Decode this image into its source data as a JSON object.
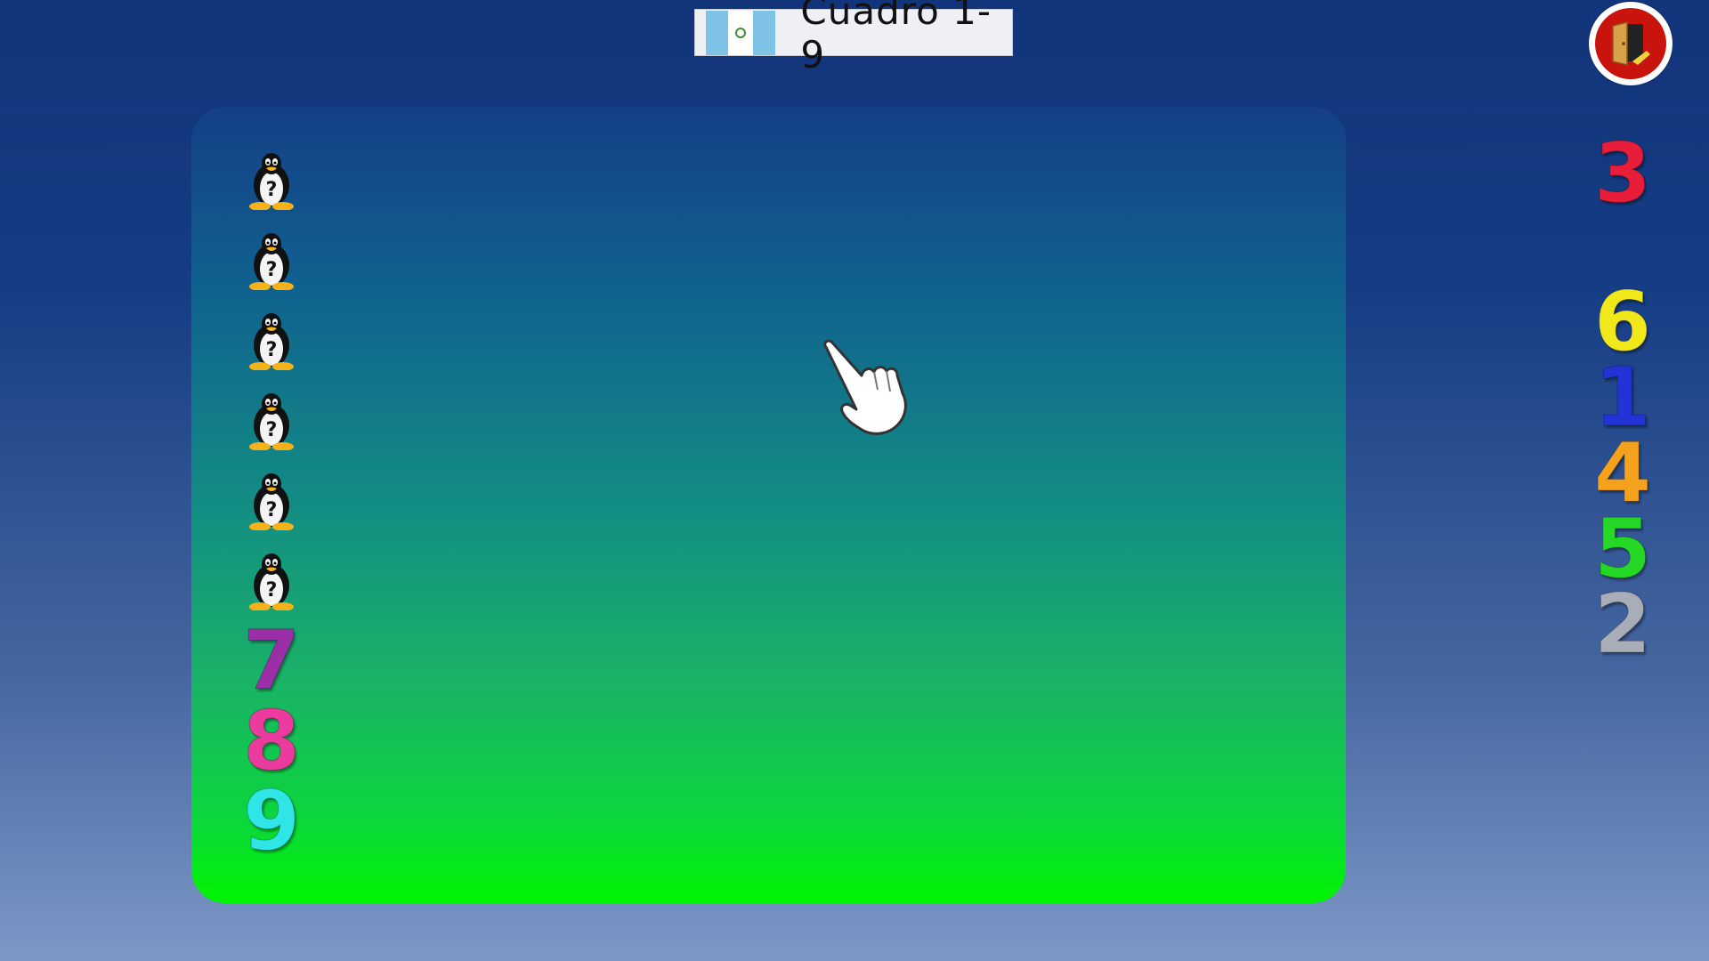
{
  "header": {
    "title": "Cuadro 1-9",
    "flag_icon": "guatemala-flag-icon"
  },
  "exit": {
    "icon": "exit-door-icon"
  },
  "board": {
    "left_column": [
      {
        "type": "penguin",
        "icon": "tux-question-icon"
      },
      {
        "type": "penguin",
        "icon": "tux-question-icon"
      },
      {
        "type": "penguin",
        "icon": "tux-question-icon"
      },
      {
        "type": "penguin",
        "icon": "tux-question-icon"
      },
      {
        "type": "penguin",
        "icon": "tux-question-icon"
      },
      {
        "type": "penguin",
        "icon": "tux-question-icon"
      },
      {
        "type": "digit",
        "value": "7",
        "color": "#9b2fa8"
      },
      {
        "type": "digit",
        "value": "8",
        "color": "#ec3b9e"
      },
      {
        "type": "digit",
        "value": "9",
        "color": "#2fe5e5"
      }
    ],
    "pointer_icon": "pointing-hand-cursor-icon"
  },
  "right_column": [
    {
      "value": "3",
      "color": "#e81d3a"
    },
    {
      "value": "6",
      "color": "#f0e81a"
    },
    {
      "value": "1",
      "color": "#2234d6"
    },
    {
      "value": "4",
      "color": "#f4a21c"
    },
    {
      "value": "5",
      "color": "#26d826"
    },
    {
      "value": "2",
      "color": "#a8adb8"
    }
  ]
}
